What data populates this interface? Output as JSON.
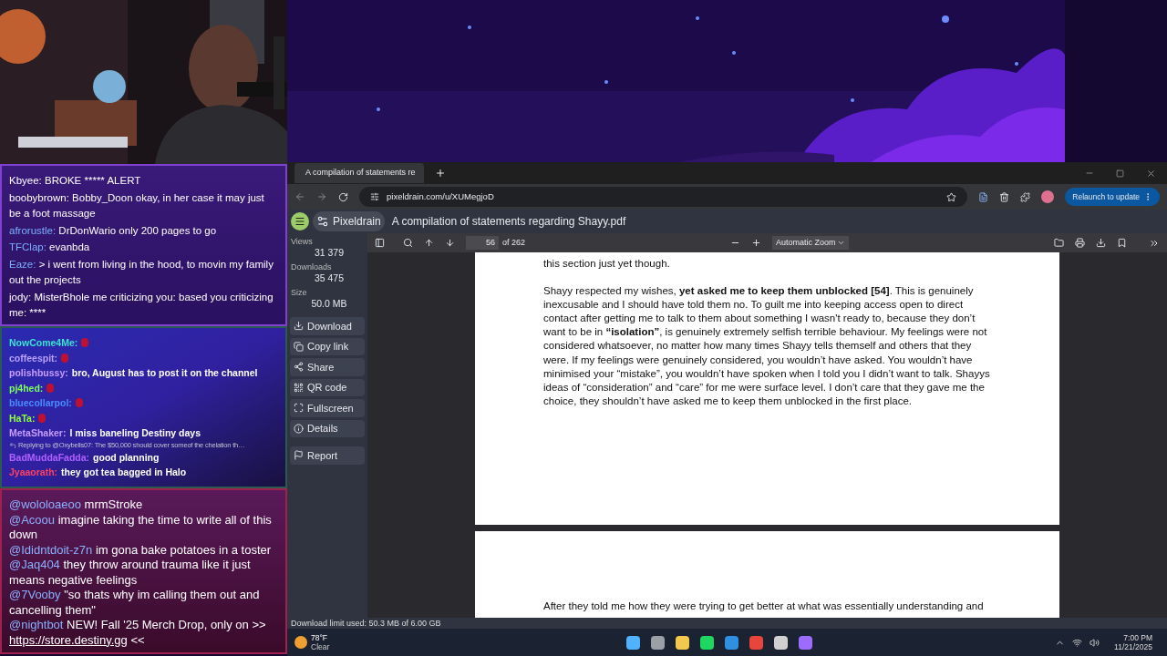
{
  "chat_top": {
    "messages": [
      {
        "user": "Kbyee:",
        "color": "#ffffff",
        "text": "BROKE ***** ALERT"
      },
      {
        "user": "boobybrown:",
        "color": "#ffffff",
        "text": "Bobby_Doon okay, in her case it may just be a foot massage"
      },
      {
        "user": "afrorustle:",
        "color": "#7ab0ff",
        "text": "DrDonWario only 200 pages to go"
      },
      {
        "user": "TFClap:",
        "color": "#7ab0ff",
        "text": "evanbda"
      },
      {
        "user": "Eaze:",
        "color": "#7ab0ff",
        "text": "> i went from living in the hood, to movin my family out the projects"
      },
      {
        "user": "jody:",
        "color": "#ffffff",
        "text": "MisterBhole me criticizing you: based  you criticizing me: ****"
      }
    ]
  },
  "chat_mid": {
    "messages": [
      {
        "kind": "message",
        "user": "NowCome4Me:",
        "color": "#3fe0d0"
      },
      {
        "kind": "message",
        "user": "coffeespit:",
        "color": "#b9a0ff"
      },
      {
        "kind": "message",
        "user": "polishbussy:",
        "color": "#c89cff",
        "text": "bro, August has to post it on the channel"
      },
      {
        "kind": "message",
        "user": "pj4hed:",
        "color": "#7cff5a"
      },
      {
        "kind": "message",
        "user": "bluecollarpol:",
        "color": "#4a8cff"
      },
      {
        "kind": "message",
        "user": "HaTa:",
        "color": "#8cff3a"
      },
      {
        "kind": "message",
        "user": "MetaShaker:",
        "color": "#c89cff",
        "text": "I miss baneling Destiny days"
      },
      {
        "kind": "reply",
        "text": "Replying to @Oxybells07: The $50,000 should cover someof the chelation th…"
      },
      {
        "kind": "message",
        "user": "BadMuddaFadda:",
        "color": "#b060ff",
        "text": "good planning"
      },
      {
        "kind": "message",
        "user": "Jyaaorath:",
        "color": "#ff4060",
        "text": "they got tea bagged in Halo"
      }
    ]
  },
  "chat_bottom": {
    "messages": [
      {
        "user": "@wololoaeoo",
        "text": "mrmStroke"
      },
      {
        "user": "@Acoou",
        "text": "imagine taking the time to write all of this down"
      },
      {
        "user": "@Ididntdoit-z7n",
        "text": "im gona bake potatoes in a toster"
      },
      {
        "user": "@Jaq404",
        "text": "they throw around trauma like it just means negative feelings"
      },
      {
        "user": "@7Vooby",
        "text": "\"so thats why im calling them out and cancelling them\""
      },
      {
        "user": "@nightbot",
        "text": "NEW! Fall '25 Merch Drop, only on >>",
        "link": "https://store.destiny.gg",
        "after": "<<"
      }
    ]
  },
  "browser": {
    "tab_title": "A compilation of statements re",
    "url": "pixeldrain.com/u/XUMegjoD",
    "relaunch_button": "Relaunch to update"
  },
  "pixeldrain": {
    "brand": "Pixeldrain",
    "file_title": "A compilation of statements regarding Shayy.pdf",
    "stats": [
      {
        "label": "Views",
        "value": "31 379"
      },
      {
        "label": "Downloads",
        "value": "35 475"
      },
      {
        "label": "Size",
        "value": "50.0 MB"
      }
    ],
    "actions": [
      "Download",
      "Copy link",
      "Share",
      "QR code",
      "Fullscreen",
      "Details",
      "Report"
    ],
    "status": "Download limit used: 50.3 MB of 6.00 GB"
  },
  "pdf": {
    "page": "56",
    "page_count": "of 262",
    "zoom": "Automatic Zoom",
    "page_one": [
      "this section just yet though.",
      "Shayy respected my wishes, **yet asked me to keep them unblocked [54]**. This is genuinely inexcusable and I should have told them no. To guilt me into keeping access open to direct contact after getting me to talk to them about something I wasn't ready to, because they don’t want to be in **“isolation”**, is genuinely extremely selfish terrible behaviour. My feelings were not considered whatsoever, no matter how many times Shayy tells themself and others that they were. If my feelings were genuinely considered, you wouldn’t have asked. You wouldn’t have minimised your “mistake”, you wouldn’t have spoken when I told you I didn’t want to talk. Shayys ideas of “consideration” and “care” for me were surface level. I don’t care that they gave me the choice, they shouldn’t have asked me to keep them unblocked in the first place."
    ],
    "page_two": [
      "After they told me how they were trying to get better at what was essentially understanding and"
    ]
  },
  "taskbar": {
    "temperature": "78°F",
    "weather": "Clear",
    "time": "7:00 PM",
    "date": "11/21/2025"
  }
}
